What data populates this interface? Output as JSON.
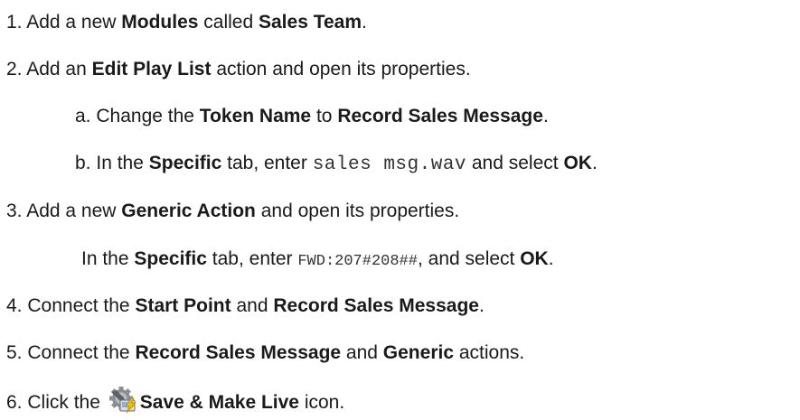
{
  "steps": {
    "s1": {
      "num": "1.",
      "t1": "Add a new ",
      "b1": "Modules",
      "t2": " called ",
      "b2": "Sales Team",
      "t3": "."
    },
    "s2": {
      "num": "2.",
      "t1": "Add an ",
      "b1": "Edit Play List",
      "t2": " action and open its properties."
    },
    "s2a": {
      "num": "a.",
      "t1": "Change the ",
      "b1": "Token Name",
      "t2": " to ",
      "b2": "Record Sales Message",
      "t3": "."
    },
    "s2b": {
      "num": "b.",
      "t1": "In the ",
      "b1": "Specific",
      "t2": " tab, enter ",
      "code": "sales msg.wav",
      "t3": " and select ",
      "b2": "OK",
      "t4": "."
    },
    "s3": {
      "num": "3.",
      "t1": "Add a new ",
      "b1": "Generic Action",
      "t2": " and open its properties."
    },
    "s3sub": {
      "t1": "In the ",
      "b1": "Specific",
      "t2": " tab, enter ",
      "code": "FWD:207#208##",
      "t3": ", and select ",
      "b2": "OK",
      "t4": "."
    },
    "s4": {
      "num": "4.",
      "t1": "Connect the ",
      "b1": "Start Point",
      "t2": " and ",
      "b2": "Record Sales Message",
      "t3": "."
    },
    "s5": {
      "num": "5.",
      "t1": "Connect the ",
      "b1": "Record Sales Message",
      "t2": " and ",
      "b2": "Generic",
      "t3": " actions."
    },
    "s6": {
      "num": "6.",
      "t1": "Click the ",
      "icon": "save-and-make-live-icon",
      "b1": "Save & Make Live",
      "t2": " icon."
    }
  }
}
